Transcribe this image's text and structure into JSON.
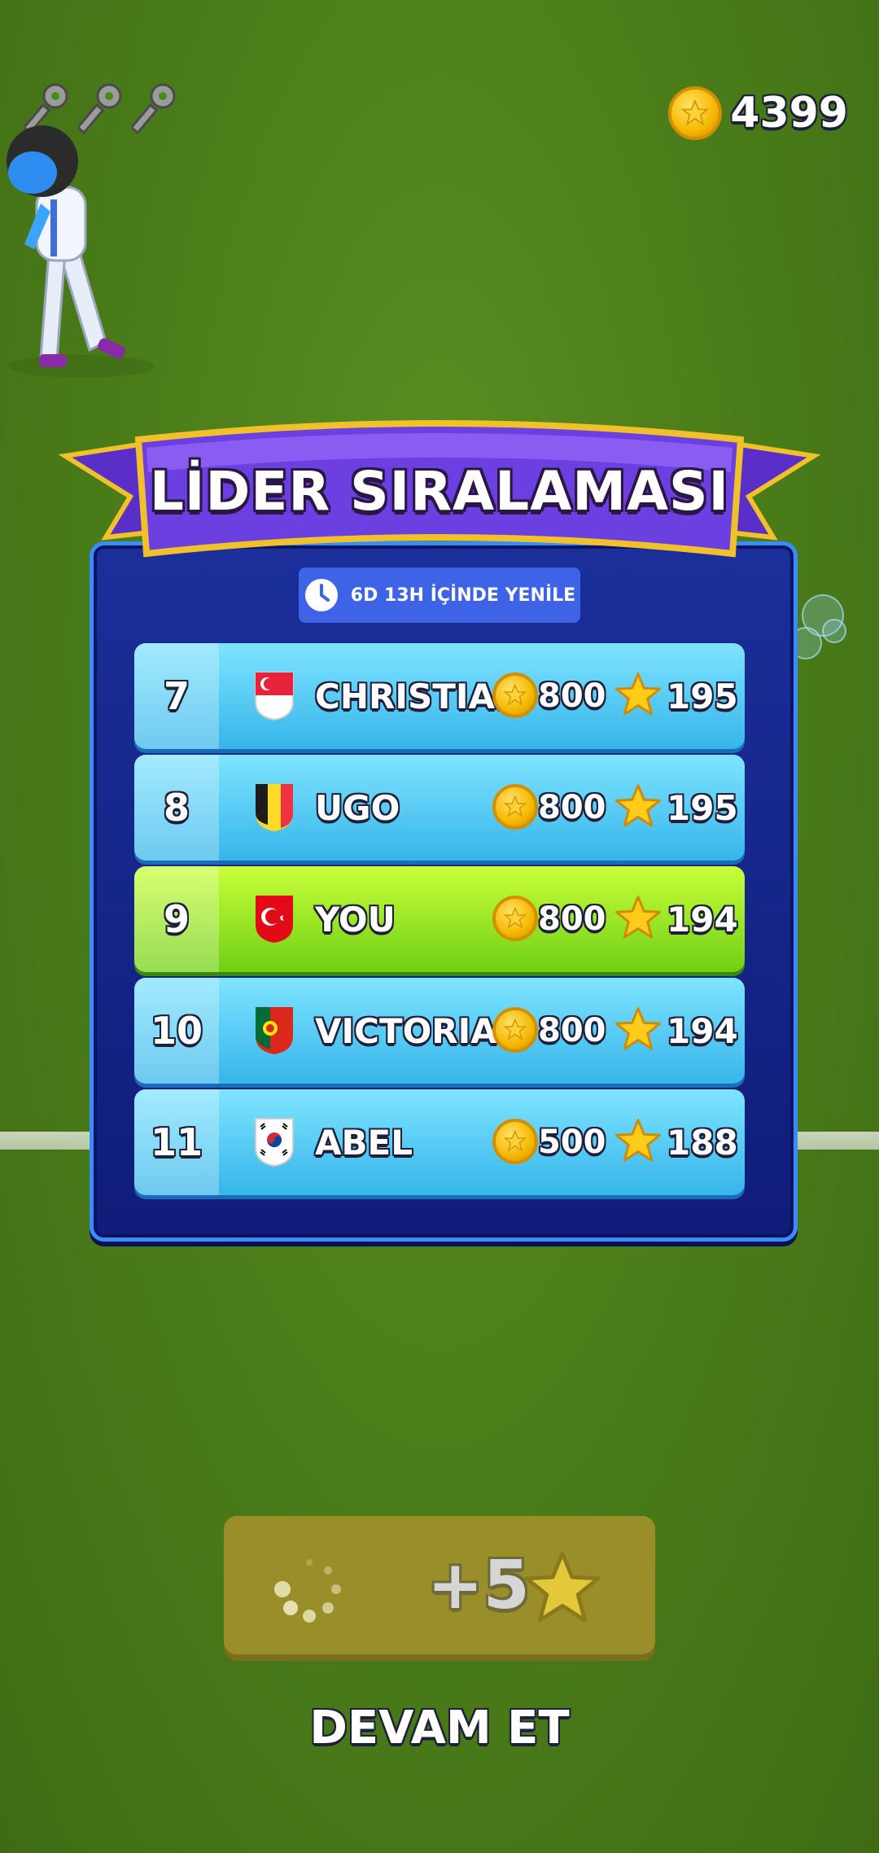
{
  "hud": {
    "keys": [
      "key-icon",
      "key-icon",
      "key-icon"
    ],
    "coins": "4399"
  },
  "leaderboard": {
    "title": "LİDER SIRALAMASI",
    "timer": "6D 13H İÇİNDE YENİLE",
    "rows": [
      {
        "rank": "7",
        "name": "CHRISTIAN",
        "flag": "singapore-flag",
        "coins": "800",
        "stars": "195",
        "me": false
      },
      {
        "rank": "8",
        "name": "UGO",
        "flag": "belgium-flag",
        "coins": "800",
        "stars": "195",
        "me": false
      },
      {
        "rank": "9",
        "name": "YOU",
        "flag": "turkey-flag",
        "coins": "800",
        "stars": "194",
        "me": true
      },
      {
        "rank": "10",
        "name": "VICTORIA",
        "flag": "portugal-flag",
        "coins": "800",
        "stars": "194",
        "me": false
      },
      {
        "rank": "11",
        "name": "ABEL",
        "flag": "south-korea-flag",
        "coins": "500",
        "stars": "188",
        "me": false
      }
    ]
  },
  "reward": {
    "amount": "+5",
    "icon": "star-icon"
  },
  "continue_label": "DEVAM ET",
  "colors": {
    "panel": "#1b2f9a",
    "row": "#4fc8f2",
    "row_me": "#9be82a",
    "ribbon": "#6b3fe0",
    "coin": "#f5b800",
    "star": "#ffcc1a"
  }
}
